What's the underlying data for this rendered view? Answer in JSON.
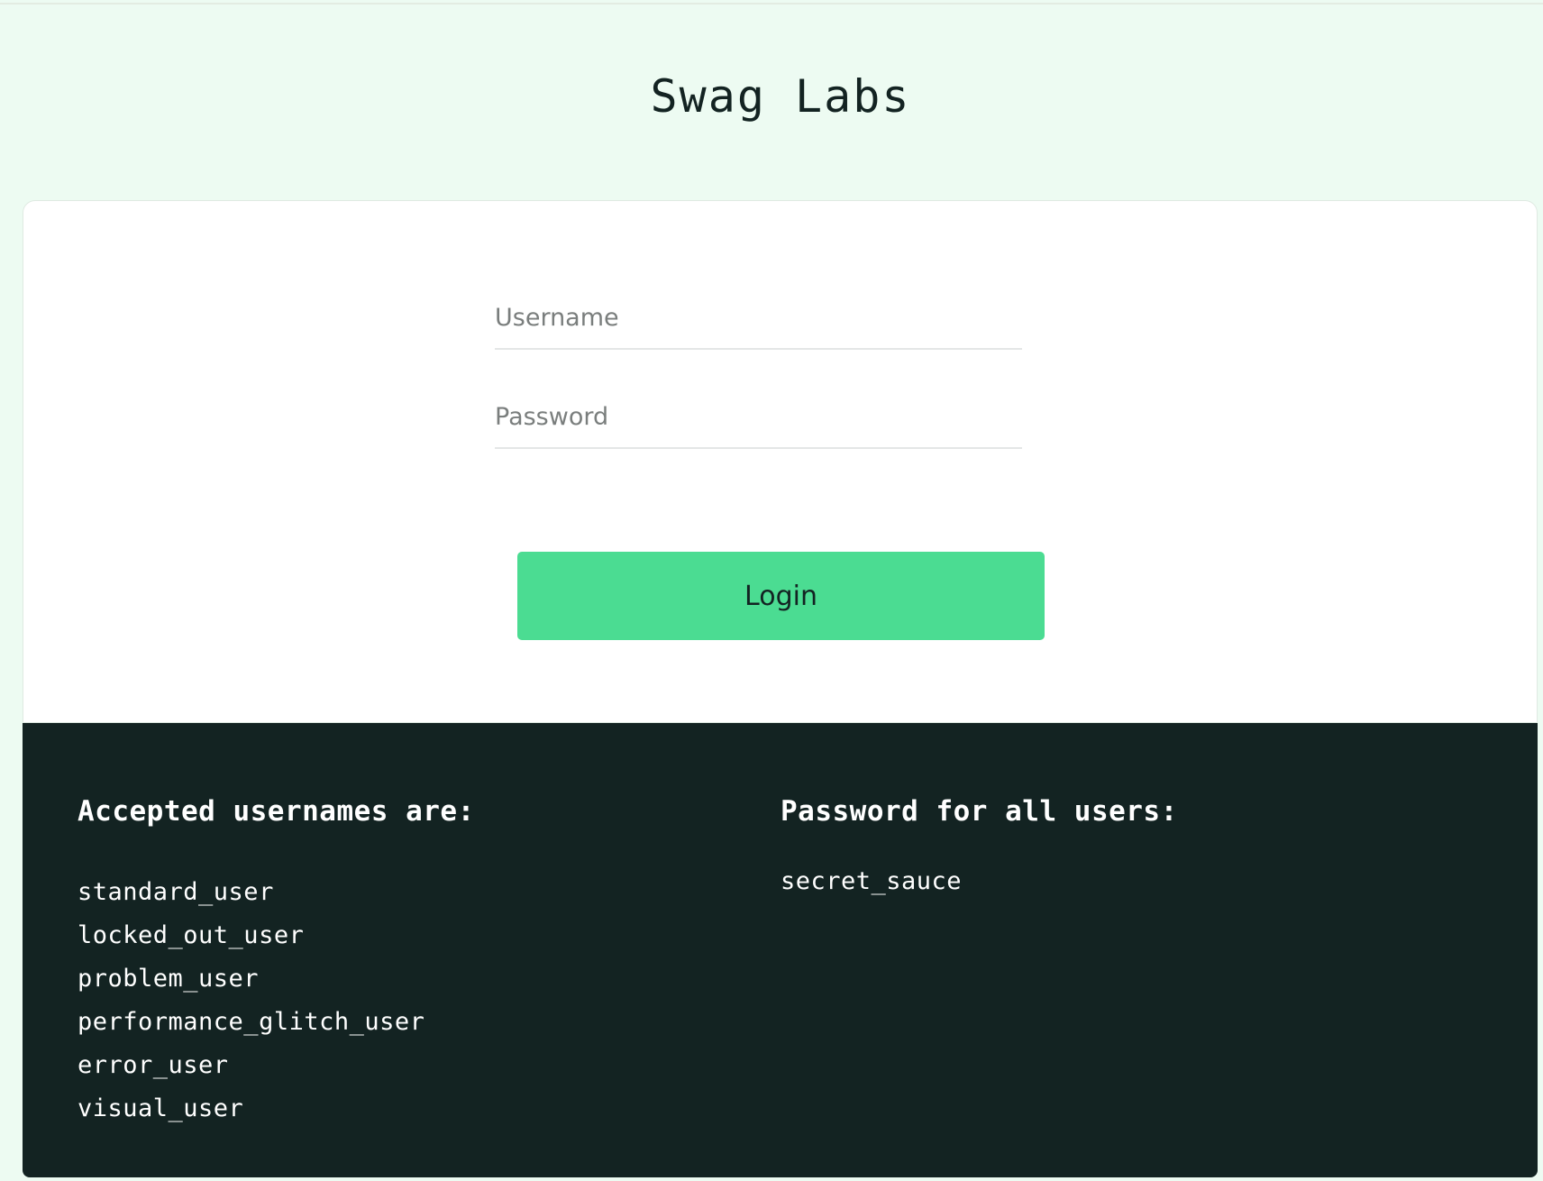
{
  "header": {
    "title": "Swag Labs"
  },
  "login_form": {
    "username_placeholder": "Username",
    "username_value": "",
    "password_placeholder": "Password",
    "password_value": "",
    "login_button_label": "Login"
  },
  "credentials": {
    "usernames_heading": "Accepted usernames are:",
    "usernames": [
      "standard_user",
      "locked_out_user",
      "problem_user",
      "performance_glitch_user",
      "error_user",
      "visual_user"
    ],
    "password_heading": "Password for all users:",
    "password": "secret_sauce"
  },
  "colors": {
    "page_background": "#edfbf2",
    "accent": "#4bdc92",
    "panel_dark": "#132322"
  }
}
